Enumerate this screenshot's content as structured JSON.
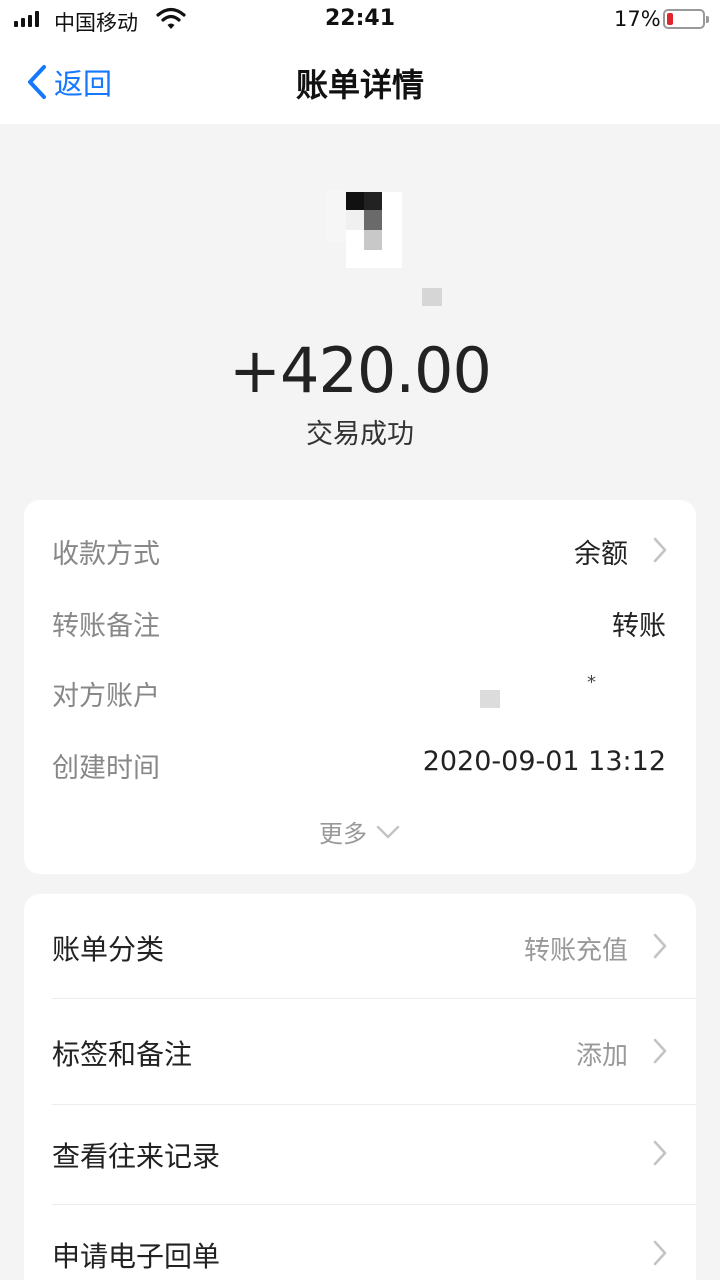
{
  "status_bar": {
    "carrier": "中国移动",
    "time": "22:41",
    "battery_percent": "17%",
    "battery_level": 0.17,
    "battery_color": "#e0262b"
  },
  "nav": {
    "back_label": "返回",
    "title": "账单详情",
    "accent_color": "#1677ff"
  },
  "transaction": {
    "amount": "+420.00",
    "status": "交易成功"
  },
  "details": {
    "rows": [
      {
        "label": "收款方式",
        "value": "余额"
      },
      {
        "label": "转账备注",
        "value": "转账"
      },
      {
        "label": "对方账户",
        "value": "*"
      },
      {
        "label": "创建时间",
        "value": "2020-09-01 13:12"
      }
    ],
    "more_label": "更多"
  },
  "actions": {
    "rows": [
      {
        "label": "账单分类",
        "value": "转账充值"
      },
      {
        "label": "标签和备注",
        "value": "添加"
      },
      {
        "label": "查看往来记录",
        "value": ""
      },
      {
        "label": "申请电子回单",
        "value": ""
      }
    ]
  }
}
